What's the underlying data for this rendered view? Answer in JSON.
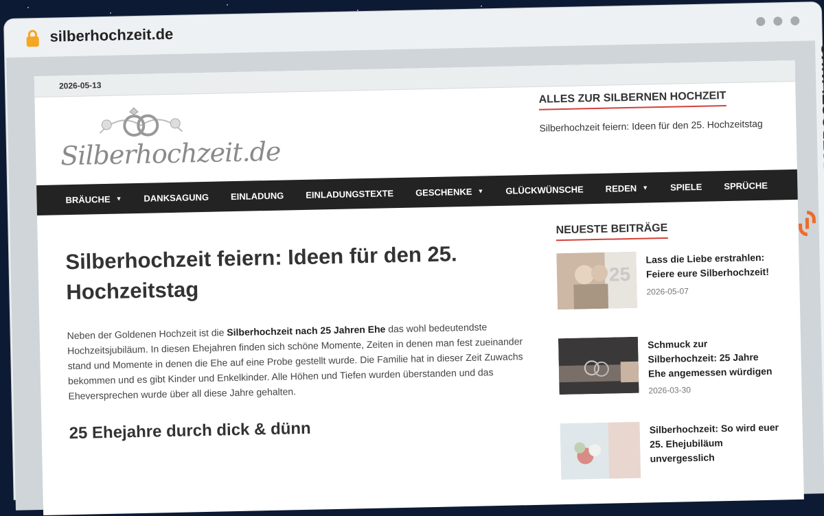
{
  "browser": {
    "url": "silberhochzeit.de"
  },
  "brand": {
    "vertical_text": "GUESTPOSTLINKS"
  },
  "site": {
    "date": "2026-05-13",
    "logo_text": "Silberhochzeit.de",
    "widget": {
      "title": "ALLES ZUR SILBERNEN HOCHZEIT",
      "text": "Silberhochzeit feiern: Ideen für den 25. Hochzeitstag"
    },
    "nav": [
      {
        "label": "BRÄUCHE",
        "dropdown": true
      },
      {
        "label": "DANKSAGUNG",
        "dropdown": false
      },
      {
        "label": "EINLADUNG",
        "dropdown": false
      },
      {
        "label": "EINLADUNGSTEXTE",
        "dropdown": false
      },
      {
        "label": "GESCHENKE",
        "dropdown": true
      },
      {
        "label": "GLÜCKWÜNSCHE",
        "dropdown": false
      },
      {
        "label": "REDEN",
        "dropdown": true
      },
      {
        "label": "SPIELE",
        "dropdown": false
      },
      {
        "label": "SPRÜCHE",
        "dropdown": false
      }
    ],
    "article": {
      "title": "Silberhochzeit feiern: Ideen für den 25. Hochzeitstag",
      "intro_before": "Neben der Goldenen Hochzeit ist die ",
      "intro_bold": "Silberhochzeit nach 25 Jahren Ehe",
      "intro_after": " das wohl bedeutendste Hochzeitsjubiläum. In diesen Ehejahren finden sich schöne Momente, Zeiten in denen man fest zueinander stand und Momente in denen die Ehe auf eine Probe gestellt wurde. Die Familie hat in dieser Zeit Zuwachs bekommen und es gibt Kinder und Enkelkinder. Alle Höhen und Tiefen wurden überstanden und das Eheversprechen wurde über all diese Jahre gehalten.",
      "h2": "25 Ehejahre durch dick & dünn"
    },
    "sidebar": {
      "title": "NEUESTE BEITRÄGE",
      "posts": [
        {
          "title": "Lass die Liebe erstrahlen: Feiere eure Silberhochzeit!",
          "date": "2026-05-07"
        },
        {
          "title": "Schmuck zur Silberhochzeit: 25 Jahre Ehe angemessen würdigen",
          "date": "2026-03-30"
        },
        {
          "title": "Silberhochzeit: So wird euer 25. Ehejubiläum unvergesslich",
          "date": ""
        }
      ]
    }
  },
  "colors": {
    "nav_bg": "#232323",
    "accent": "#d43f3a",
    "brand_orange": "#f06a2b"
  }
}
